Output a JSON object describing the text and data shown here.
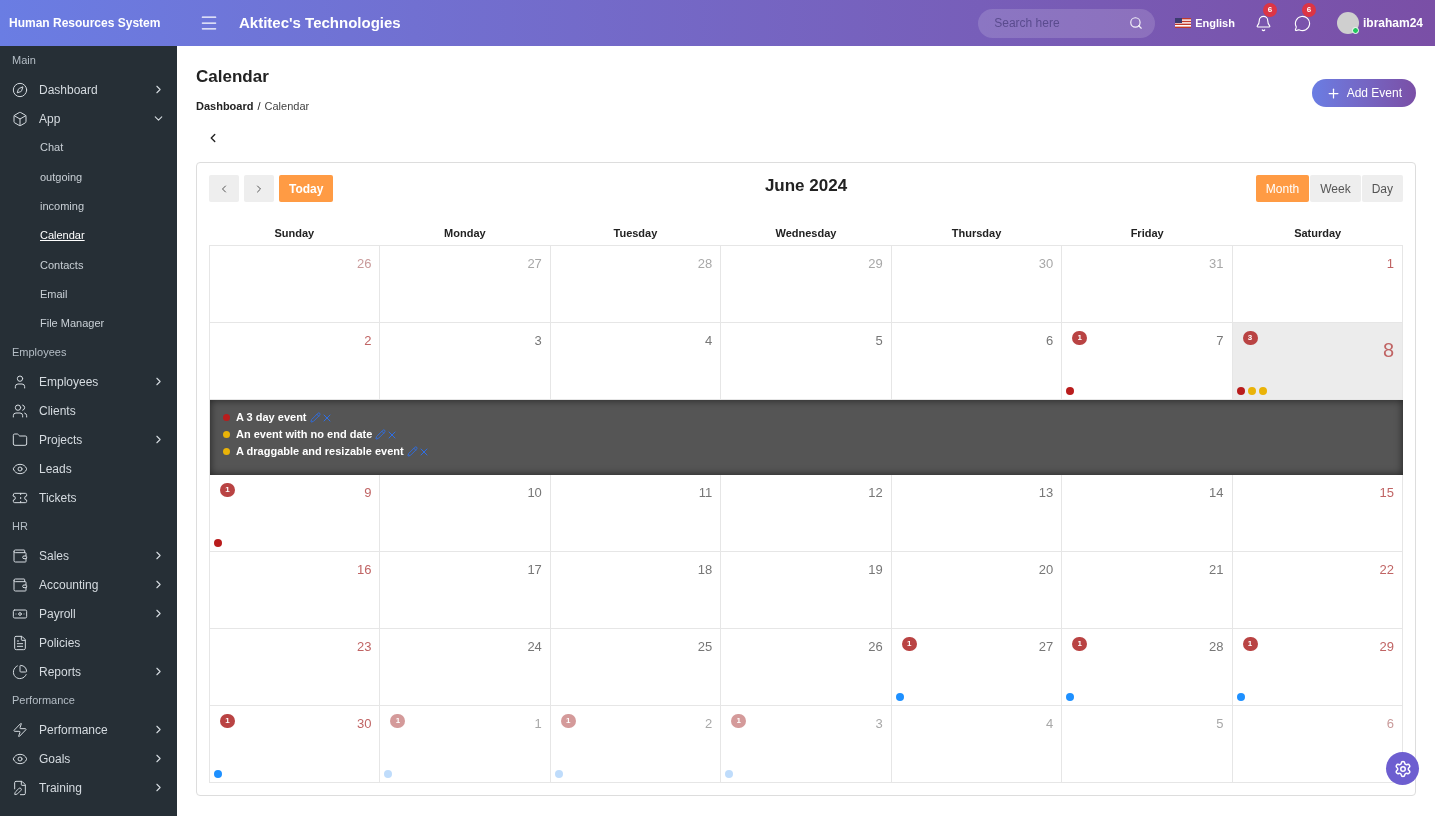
{
  "brand": "Human Resources System",
  "company": "Aktitec's Technologies",
  "search": {
    "placeholder": "Search here"
  },
  "language": "English",
  "notifications": {
    "count": "6"
  },
  "messages": {
    "count": "6"
  },
  "user": {
    "name": "ibraham24",
    "online": true
  },
  "sidebar": {
    "items": [
      {
        "kind": "section",
        "label": "Main"
      },
      {
        "kind": "group",
        "label": "Dashboard",
        "expanded": false
      },
      {
        "kind": "group",
        "label": "App",
        "expanded": true,
        "children": [
          {
            "label": "Chat",
            "selected": false
          },
          {
            "label": "outgoing",
            "selected": false
          },
          {
            "label": "incoming",
            "selected": false
          },
          {
            "label": "Calendar",
            "selected": true
          },
          {
            "label": "Contacts",
            "selected": false
          },
          {
            "label": "Email",
            "selected": false
          },
          {
            "label": "File Manager",
            "selected": false
          }
        ]
      },
      {
        "kind": "section",
        "label": "Employees"
      },
      {
        "kind": "group",
        "label": "Employees",
        "expanded": false
      },
      {
        "kind": "item",
        "label": "Clients"
      },
      {
        "kind": "group",
        "label": "Projects",
        "expanded": false
      },
      {
        "kind": "item",
        "label": "Leads"
      },
      {
        "kind": "item",
        "label": "Tickets"
      },
      {
        "kind": "section",
        "label": "HR"
      },
      {
        "kind": "group",
        "label": "Sales",
        "expanded": false
      },
      {
        "kind": "group",
        "label": "Accounting",
        "expanded": false
      },
      {
        "kind": "group",
        "label": "Payroll",
        "expanded": false
      },
      {
        "kind": "item",
        "label": "Policies"
      },
      {
        "kind": "group",
        "label": "Reports",
        "expanded": false
      },
      {
        "kind": "section",
        "label": "Performance"
      },
      {
        "kind": "group",
        "label": "Performance",
        "expanded": false
      },
      {
        "kind": "group",
        "label": "Goals",
        "expanded": false
      },
      {
        "kind": "group",
        "label": "Training",
        "expanded": false
      }
    ]
  },
  "page": {
    "title": "Calendar",
    "breadcrumb": [
      "Dashboard",
      "Calendar"
    ],
    "breadcrumb_separator": "/",
    "add_button": "Add Event"
  },
  "calendar": {
    "title": "June 2024",
    "today_button": "Today",
    "views": [
      {
        "label": "Month",
        "selected": true
      },
      {
        "label": "Week",
        "selected": false
      },
      {
        "label": "Day",
        "selected": false
      }
    ],
    "weekdays": [
      "Sunday",
      "Monday",
      "Tuesday",
      "Wednesday",
      "Thursday",
      "Friday",
      "Saturday"
    ],
    "weeks": [
      {
        "days": [
          {
            "day": "26",
            "outside": true,
            "selected": false
          },
          {
            "day": "27",
            "outside": true,
            "selected": false
          },
          {
            "day": "28",
            "outside": true,
            "selected": false
          },
          {
            "day": "29",
            "outside": true,
            "selected": false
          },
          {
            "day": "30",
            "outside": true,
            "selected": false
          },
          {
            "day": "31",
            "outside": true,
            "selected": false
          },
          {
            "day": "1",
            "outside": false,
            "selected": false
          }
        ]
      },
      {
        "days": [
          {
            "day": "2",
            "outside": false,
            "selected": false
          },
          {
            "day": "3",
            "outside": false,
            "selected": false
          },
          {
            "day": "4",
            "outside": false,
            "selected": false
          },
          {
            "day": "5",
            "outside": false,
            "selected": false
          },
          {
            "day": "6",
            "outside": false,
            "selected": false
          },
          {
            "day": "7",
            "outside": false,
            "selected": false,
            "count": "1",
            "dots": [
              {
                "color": "#b91c1c"
              }
            ]
          },
          {
            "day": "8",
            "outside": false,
            "selected": true,
            "count": "3",
            "dots": [
              {
                "color": "#b91c1c"
              },
              {
                "color": "#eab308"
              },
              {
                "color": "#eab308"
              }
            ]
          }
        ],
        "expanded_events": [
          {
            "title": "A 3 day event",
            "color": "#b91c1c"
          },
          {
            "title": "An event with no end date",
            "color": "#eab308"
          },
          {
            "title": "A draggable and resizable event",
            "color": "#eab308"
          }
        ]
      },
      {
        "days": [
          {
            "day": "9",
            "outside": false,
            "selected": false,
            "count": "1",
            "dots": [
              {
                "color": "#b91c1c"
              }
            ]
          },
          {
            "day": "10",
            "outside": false,
            "selected": false
          },
          {
            "day": "11",
            "outside": false,
            "selected": false
          },
          {
            "day": "12",
            "outside": false,
            "selected": false
          },
          {
            "day": "13",
            "outside": false,
            "selected": false
          },
          {
            "day": "14",
            "outside": false,
            "selected": false
          },
          {
            "day": "15",
            "outside": false,
            "selected": false
          }
        ]
      },
      {
        "days": [
          {
            "day": "16",
            "outside": false,
            "selected": false
          },
          {
            "day": "17",
            "outside": false,
            "selected": false
          },
          {
            "day": "18",
            "outside": false,
            "selected": false
          },
          {
            "day": "19",
            "outside": false,
            "selected": false
          },
          {
            "day": "20",
            "outside": false,
            "selected": false
          },
          {
            "day": "21",
            "outside": false,
            "selected": false
          },
          {
            "day": "22",
            "outside": false,
            "selected": false
          }
        ]
      },
      {
        "days": [
          {
            "day": "23",
            "outside": false,
            "selected": false
          },
          {
            "day": "24",
            "outside": false,
            "selected": false
          },
          {
            "day": "25",
            "outside": false,
            "selected": false
          },
          {
            "day": "26",
            "outside": false,
            "selected": false
          },
          {
            "day": "27",
            "outside": false,
            "selected": false,
            "count": "1",
            "dots": [
              {
                "color": "#1e90ff"
              }
            ]
          },
          {
            "day": "28",
            "outside": false,
            "selected": false,
            "count": "1",
            "dots": [
              {
                "color": "#1e90ff"
              }
            ]
          },
          {
            "day": "29",
            "outside": false,
            "selected": false,
            "count": "1",
            "dots": [
              {
                "color": "#1e90ff"
              }
            ]
          }
        ]
      },
      {
        "days": [
          {
            "day": "30",
            "outside": false,
            "selected": false,
            "count": "1",
            "dots": [
              {
                "color": "#1e90ff"
              }
            ]
          },
          {
            "day": "1",
            "outside": true,
            "selected": false,
            "count": "1",
            "dots": [
              {
                "color": "#bfdcfb"
              }
            ]
          },
          {
            "day": "2",
            "outside": true,
            "selected": false,
            "count": "1",
            "dots": [
              {
                "color": "#bfdcfb"
              }
            ]
          },
          {
            "day": "3",
            "outside": true,
            "selected": false,
            "count": "1",
            "dots": [
              {
                "color": "#bfdcfb"
              }
            ]
          },
          {
            "day": "4",
            "outside": true,
            "selected": false
          },
          {
            "day": "5",
            "outside": true,
            "selected": false
          },
          {
            "day": "6",
            "outside": true,
            "selected": false
          }
        ]
      }
    ]
  }
}
